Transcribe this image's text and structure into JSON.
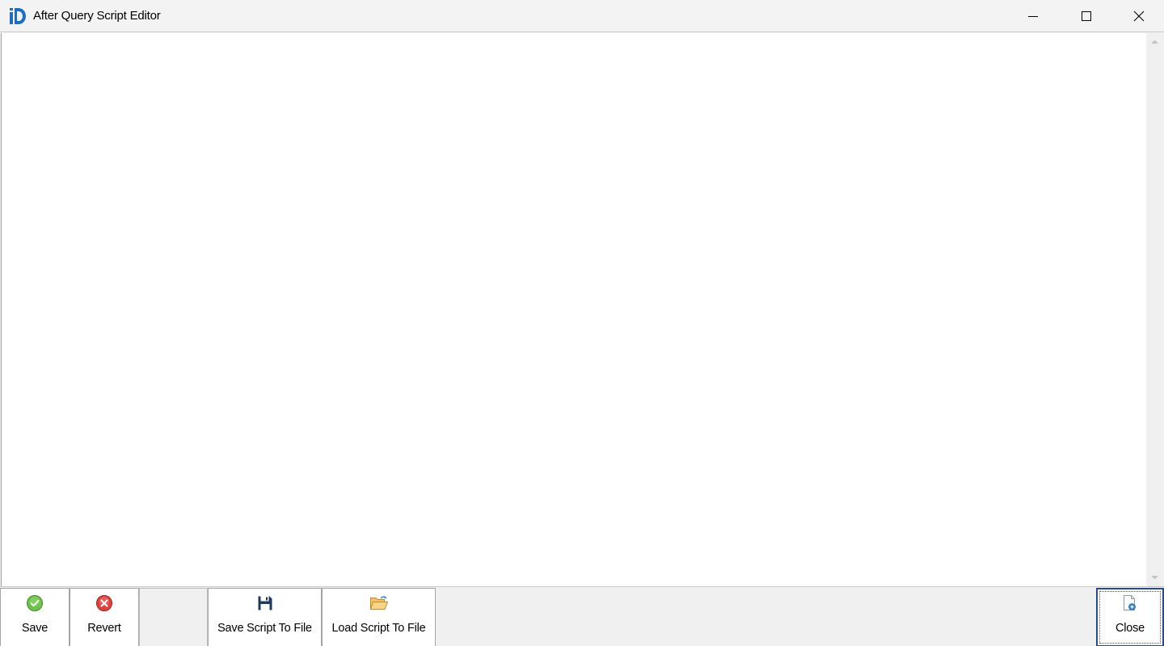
{
  "window": {
    "title": "After Query Script Editor",
    "app_icon": "app-logo-icon",
    "controls": {
      "minimize_icon": "minimize-icon",
      "maximize_icon": "maximize-icon",
      "close_icon": "close-icon"
    }
  },
  "editor": {
    "content": ""
  },
  "toolbar": {
    "save_label": "Save",
    "revert_label": "Revert",
    "save_script_label": "Save Script To File",
    "load_script_label": "Load Script To File",
    "close_label": "Close"
  },
  "colors": {
    "accent_blue": "#1e6fc3",
    "save_green": "#5cb82e",
    "revert_red": "#d9322b",
    "folder_orange": "#e8a43a"
  }
}
